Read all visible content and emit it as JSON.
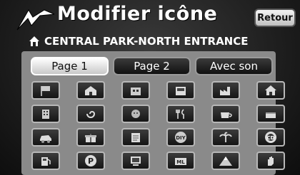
{
  "header": {
    "title": "Modifier icône",
    "back_label": "Retour"
  },
  "destination": {
    "name": "CENTRAL PARK-NORTH ENTRANCE",
    "icon": "house-icon"
  },
  "tabs": [
    {
      "label": "Page 1",
      "active": true
    },
    {
      "label": "Page 2",
      "active": false
    },
    {
      "label": "Avec son",
      "active": false
    }
  ],
  "icons": [
    [
      "flag-icon",
      "house-icon",
      "building-icon",
      "shop-icon",
      "factory-icon",
      "home-icon"
    ],
    [
      "tower-icon",
      "swirl-icon",
      "circle-face-icon",
      "restaurant-icon",
      "coffee-icon",
      "cake-icon"
    ],
    [
      "car-icon",
      "gift-icon",
      "document-icon",
      "diy-icon",
      "palm-icon",
      "cd-icon"
    ],
    [
      "fuel-icon",
      "parking-icon",
      "monitor-icon",
      "mail-icon",
      "mountain-icon",
      "hand-icon"
    ]
  ],
  "icon_texts": {
    "diy": "DIY",
    "cd": "CD",
    "parking": "P",
    "mail": "ML"
  }
}
